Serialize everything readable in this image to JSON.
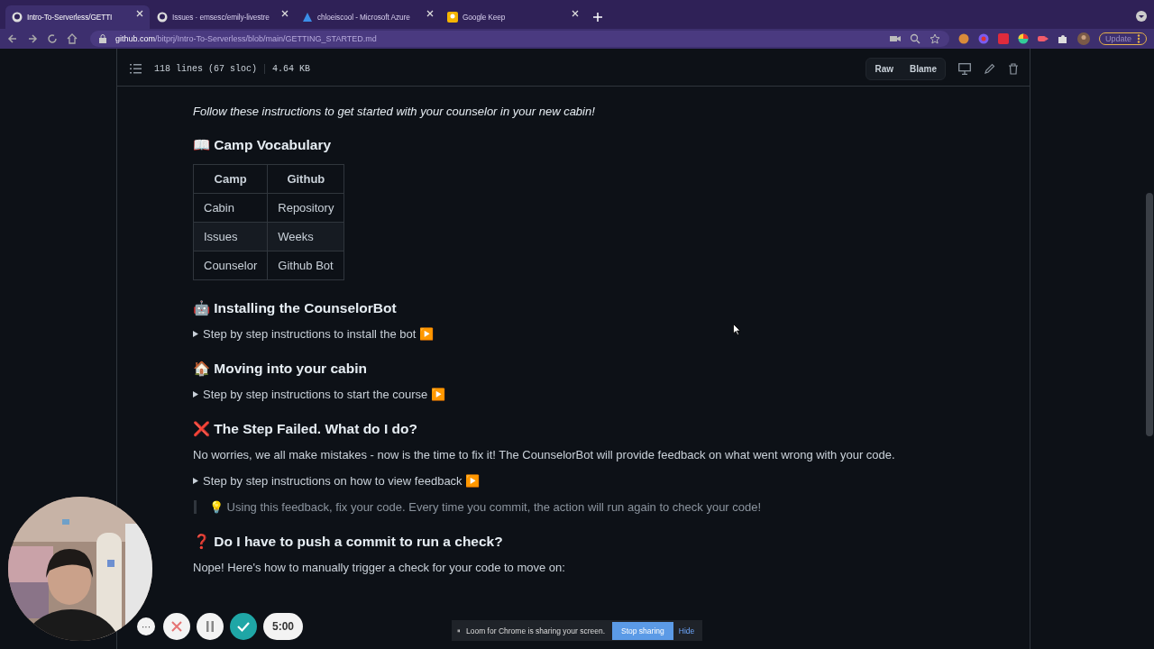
{
  "browser": {
    "tabs": [
      {
        "title": "Intro-To-Serverless/GETTI",
        "selected": true
      },
      {
        "title": "Issues · emsesc/emily-livestre",
        "selected": false
      },
      {
        "title": "chloeiscool - Microsoft Azure",
        "selected": false
      },
      {
        "title": "Google Keep",
        "selected": false
      }
    ],
    "url_host": "github.com",
    "url_path": "/bitprj/Intro-To-Serverless/blob/main/GETTING_STARTED.md",
    "update_label": "Update"
  },
  "file_header": {
    "lines": "118 lines (67 sloc)",
    "size": "4.64 KB",
    "buttons": [
      "Raw",
      "Blame"
    ]
  },
  "intro": "Follow these instructions to get started with your counselor in your new cabin!",
  "sections": [
    {
      "kind": "table",
      "emoji": "📖",
      "heading": "Camp Vocabulary",
      "columns": [
        "Camp",
        "Github"
      ],
      "rows": [
        [
          "Cabin",
          "Repository"
        ],
        [
          "Issues",
          "Weeks"
        ],
        [
          "Counselor",
          "Github Bot"
        ]
      ]
    },
    {
      "kind": "details",
      "emoji": "🤖",
      "heading": "Installing the CounselorBot",
      "summary": "Step by step instructions to install the bot ▶️"
    },
    {
      "kind": "details",
      "emoji": "🏠",
      "heading": "Moving into your cabin",
      "summary": "Step by step instructions to start the course ▶️"
    },
    {
      "kind": "details",
      "emoji": "❌",
      "heading": "The Step Failed. What do I do?",
      "paragraph": "No worries, we all make mistakes - now is the time to fix it! The CounselorBot will provide feedback on what went wrong with your code.",
      "summary": "Step by step instructions on how to view feedback ▶️",
      "quote": "💡 Using this feedback, fix your code. Every time you commit, the action will run again to check your code!"
    },
    {
      "kind": "text",
      "emoji": "❓",
      "heading": "Do I have to push a commit to run a check?",
      "paragraph": "Nope! Here's how to manually trigger a check for your code to move on:"
    }
  ],
  "recorder": {
    "timer": "5:00",
    "more": "···",
    "banner": "Loom for Chrome is sharing your screen.",
    "stop": "Stop sharing",
    "hide": "Hide",
    "pause_glyph": "⏸"
  }
}
